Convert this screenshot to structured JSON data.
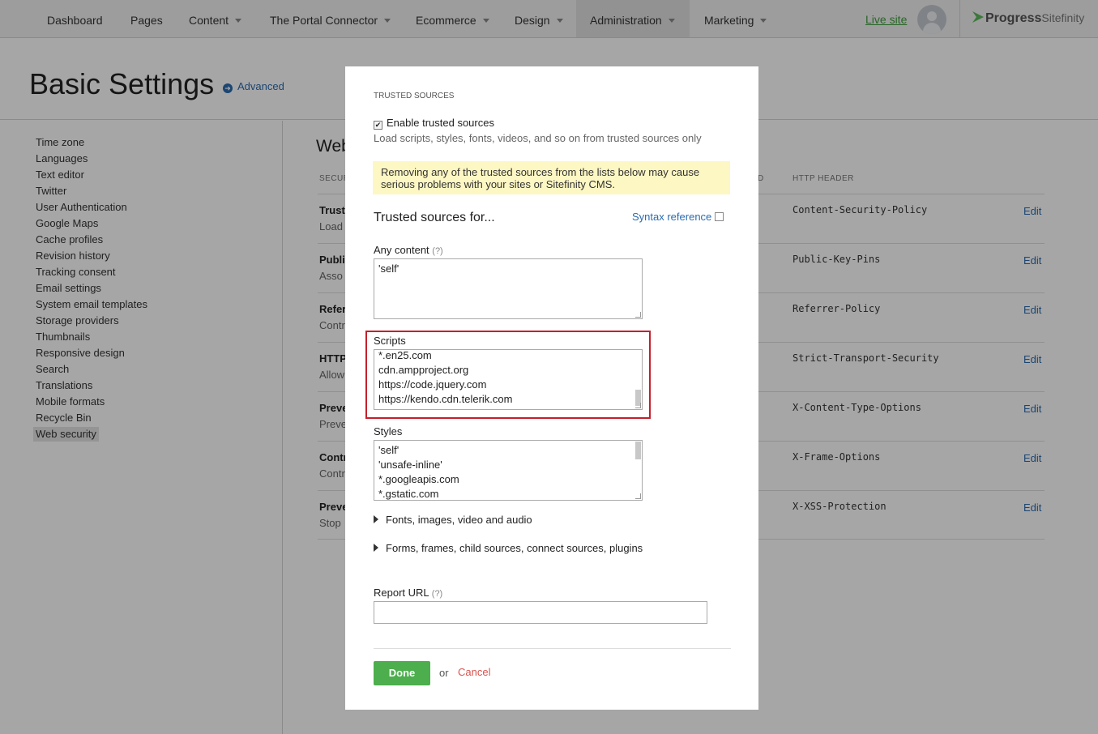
{
  "nav": {
    "items": [
      {
        "label": "Dashboard",
        "caret": false
      },
      {
        "label": "Pages",
        "caret": false
      },
      {
        "label": "Content",
        "caret": true
      },
      {
        "label": "The Portal Connector",
        "caret": true
      },
      {
        "label": "Ecommerce",
        "caret": true
      },
      {
        "label": "Design",
        "caret": true
      },
      {
        "label": "Administration",
        "caret": true,
        "active": true
      },
      {
        "label": "Marketing",
        "caret": true
      }
    ],
    "live_site": "Live site",
    "brand": "Progress",
    "brand_product": "Sitefinity"
  },
  "page": {
    "title": "Basic Settings",
    "advanced": "Advanced"
  },
  "sidebar": {
    "items": [
      "Time zone",
      "Languages",
      "Text editor",
      "Twitter",
      "User Authentication",
      "Google Maps",
      "Cache profiles",
      "Revision history",
      "Tracking consent",
      "Email settings",
      "System email templates",
      "Storage providers",
      "Thumbnails",
      "Responsive design",
      "Search",
      "Translations",
      "Mobile formats",
      "Recycle Bin",
      "Web security"
    ],
    "active": "Web security"
  },
  "main": {
    "title": "Web",
    "col_security": "SECUR",
    "col_d": "D",
    "col_header": "HTTP HEADER",
    "rows": [
      {
        "title": "Trust",
        "desc": "Load",
        "header": "Content-Security-Policy",
        "edit": "Edit"
      },
      {
        "title": "Publi",
        "desc": "Asso",
        "header": "Public-Key-Pins",
        "edit": "Edit"
      },
      {
        "title": "Refer",
        "desc": "Contr",
        "header": "Referrer-Policy",
        "edit": "Edit"
      },
      {
        "title": "HTTP",
        "desc": "Allow",
        "header": "Strict-Transport-Security",
        "edit": "Edit"
      },
      {
        "title": "Preve",
        "desc": "Preve",
        "header": "X-Content-Type-Options",
        "edit": "Edit"
      },
      {
        "title": "Contr",
        "desc": "Contr",
        "header": "X-Frame-Options",
        "edit": "Edit"
      },
      {
        "title": "Preve",
        "desc": "Stop",
        "header": "X-XSS-Protection",
        "edit": "Edit"
      }
    ]
  },
  "modal": {
    "section": "TRUSTED SOURCES",
    "enable_label": "Enable trusted sources",
    "enable_checked": true,
    "enable_hint": "Load scripts, styles, fonts, videos, and so on from trusted sources only",
    "warning": "Removing any of the trusted sources from the lists below may cause serious problems with your sites or Sitefinity CMS.",
    "subtitle": "Trusted sources for...",
    "syntax_ref": "Syntax reference",
    "any_content_label": "Any content",
    "help": "(?)",
    "any_content": [
      "'self'"
    ],
    "scripts_label": "Scripts",
    "scripts": [
      "*.en25.com",
      "cdn.ampproject.org",
      "https://code.jquery.com",
      "https://kendo.cdn.telerik.com"
    ],
    "styles_label": "Styles",
    "styles": [
      "'self'",
      "'unsafe-inline'",
      "*.googleapis.com",
      "*.gstatic.com"
    ],
    "expand1": "Fonts, images, video and audio",
    "expand2": "Forms, frames, child sources, connect sources, plugins",
    "report_label": "Report URL",
    "report_value": "",
    "done": "Done",
    "or": "or",
    "cancel": "Cancel"
  }
}
